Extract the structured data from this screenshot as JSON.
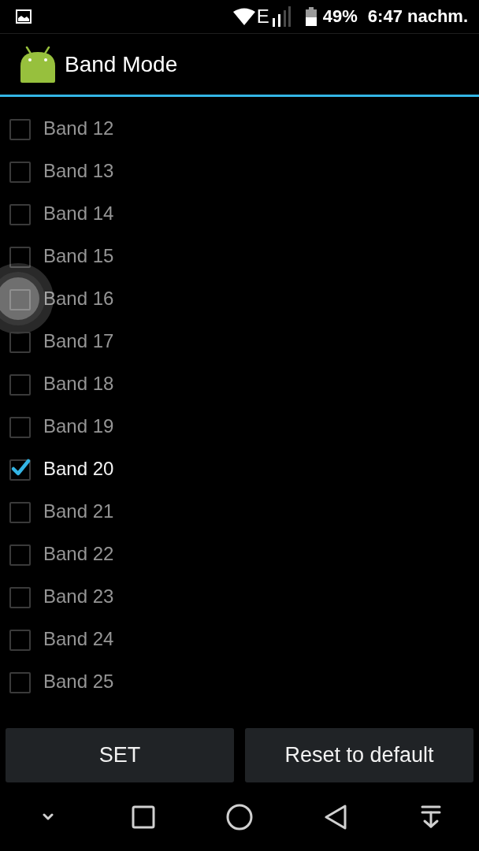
{
  "status_bar": {
    "network_type": "E",
    "battery_text": "49%",
    "time": "6:47 nachm."
  },
  "app_bar": {
    "title": "Band Mode"
  },
  "bands": [
    {
      "label": "Band 12",
      "checked": false,
      "touched": false
    },
    {
      "label": "Band 13",
      "checked": false,
      "touched": false
    },
    {
      "label": "Band 14",
      "checked": false,
      "touched": false
    },
    {
      "label": "Band 15",
      "checked": false,
      "touched": false
    },
    {
      "label": "Band 16",
      "checked": false,
      "touched": true
    },
    {
      "label": "Band 17",
      "checked": false,
      "touched": false
    },
    {
      "label": "Band 18",
      "checked": false,
      "touched": false
    },
    {
      "label": "Band 19",
      "checked": false,
      "touched": false
    },
    {
      "label": "Band 20",
      "checked": true,
      "touched": false
    },
    {
      "label": "Band 21",
      "checked": false,
      "touched": false
    },
    {
      "label": "Band 22",
      "checked": false,
      "touched": false
    },
    {
      "label": "Band 23",
      "checked": false,
      "touched": false
    },
    {
      "label": "Band 24",
      "checked": false,
      "touched": false
    },
    {
      "label": "Band 25",
      "checked": false,
      "touched": false
    }
  ],
  "buttons": [
    "SET",
    "Reset to default"
  ]
}
